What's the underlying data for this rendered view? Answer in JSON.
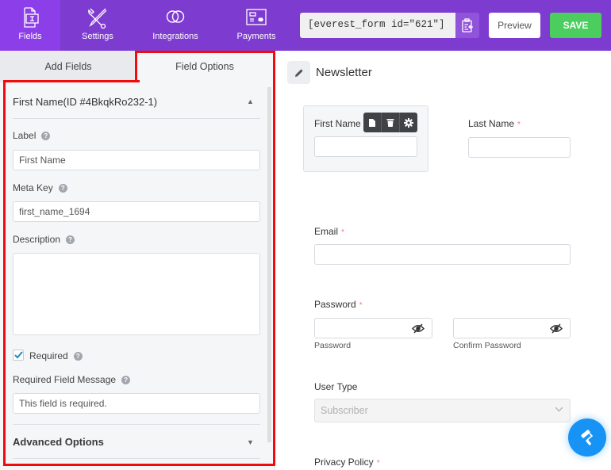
{
  "nav": {
    "items": [
      {
        "label": "Fields",
        "icon": "fields-icon",
        "active": true
      },
      {
        "label": "Settings",
        "icon": "settings-tools-icon",
        "active": false
      },
      {
        "label": "Integrations",
        "icon": "integrations-rings-icon",
        "active": false
      },
      {
        "label": "Payments",
        "icon": "payments-card-icon",
        "active": false
      }
    ],
    "shortcode": "[everest_form id=\"621\"]",
    "copy_icon": "clipboard-copy-icon",
    "preview_label": "Preview",
    "save_label": "SAVE"
  },
  "left_panel": {
    "tabs": [
      {
        "label": "Add Fields",
        "active": false
      },
      {
        "label": "Field Options",
        "active": true
      }
    ],
    "section_title": "First Name(ID #4BkqkRo232-1)",
    "section_collapse_icon": "triangle-up-icon",
    "fields": {
      "label": {
        "label": "Label",
        "value": "First Name"
      },
      "meta_key": {
        "label": "Meta Key",
        "value": "first_name_1694"
      },
      "description": {
        "label": "Description",
        "value": ""
      },
      "required": {
        "label": "Required",
        "checked": true
      },
      "required_message": {
        "label": "Required Field Message",
        "value": "This field is required."
      }
    },
    "help_glyph": "?",
    "advanced_label": "Advanced Options",
    "advanced_expand_icon": "triangle-down-icon"
  },
  "canvas": {
    "form_title": "Newsletter",
    "required_mark": "*",
    "fields": {
      "first_name": {
        "label": "First Name"
      },
      "last_name": {
        "label": "Last Name"
      },
      "email": {
        "label": "Email"
      },
      "password": {
        "label": "Password",
        "sub_label": "Password",
        "confirm_sub_label": "Confirm Password"
      },
      "user_type": {
        "label": "User Type",
        "selected": "Subscriber"
      },
      "privacy_policy": {
        "label": "Privacy Policy"
      }
    },
    "field_toolbar": [
      "duplicate-icon",
      "trash-icon",
      "gear-icon"
    ],
    "fab_icon": "paint-roller-icon"
  },
  "colors": {
    "header_bg": "#7e3bd0",
    "active_nav_bg": "#8c3ee8",
    "save_green": "#4cce5f",
    "highlight_red": "#f30b0b",
    "fab_blue": "#1693f5",
    "required_red": "#f07a7a"
  }
}
